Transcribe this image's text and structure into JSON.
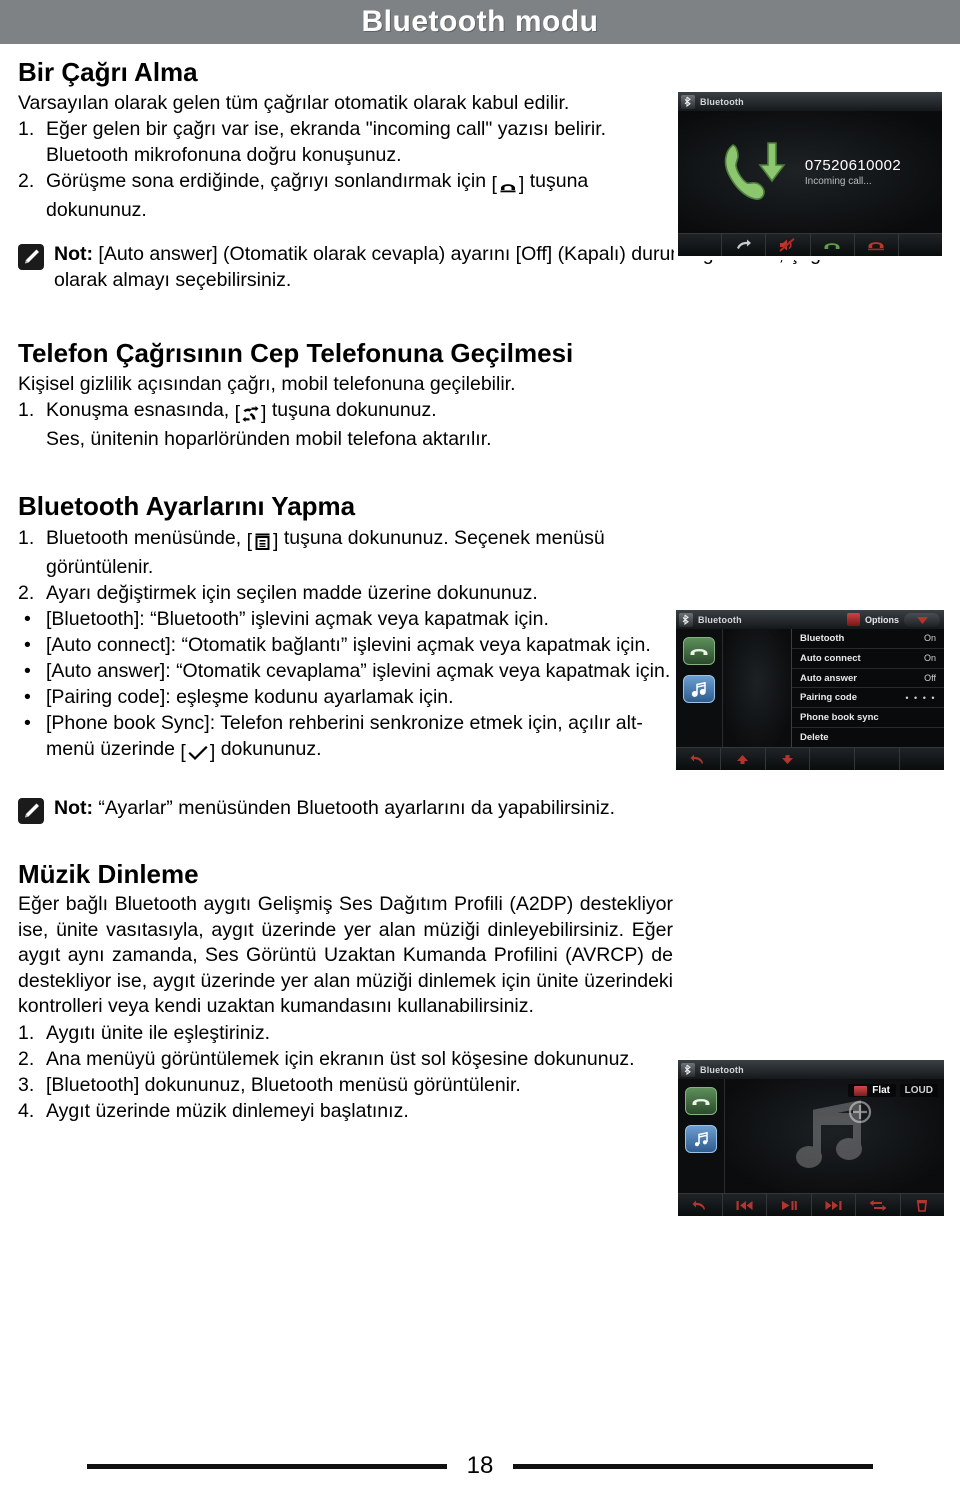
{
  "header": {
    "title": "Bluetooth modu",
    "band_color": "#7f8285"
  },
  "sections": {
    "receiving_call": {
      "heading": "Bir Çağrı Alma",
      "intro": "Varsayılan olarak gelen tüm çağrılar otomatik olarak kabul edilir.",
      "steps": [
        {
          "marker": "1.",
          "text": "Eğer gelen bir çağrı var ise, ekranda \"incoming call\" yazısı belirir. Bluetooth mikrofonuna doğru konuşunuz."
        },
        {
          "marker": "2.",
          "text_before": "Görüşme sona erdiğinde, çağrıyı sonlandırmak için",
          "icon": "hangup-handset-icon",
          "text_after": "tuşuna dokununuz."
        }
      ]
    },
    "note_1": {
      "icon": "pencil-note-icon",
      "label": "Not:",
      "text": " [Auto answer] (Otomatik olarak cevapla) ayarını [Off] (Kapalı) duruma getirerek, çağrıları manüel olarak almayı seçebilirsiniz."
    },
    "transfer_call": {
      "heading": "Telefon Çağrısının Cep Telefonuna Geçilmesi",
      "intro": "Kişisel gizlilik açısından çağrı, mobil telefonuna geçilebilir.",
      "steps": [
        {
          "marker": "1.",
          "text_before": "Konuşma esnasında,",
          "icon": "call-transfer-icon",
          "text_after": "tuşuna dokununuz."
        },
        {
          "marker": "",
          "text": "Ses, ünitenin hoparlöründen mobil telefona aktarılır."
        }
      ]
    },
    "bt_settings": {
      "heading": "Bluetooth Ayarlarını Yapma",
      "steps": [
        {
          "marker": "1.",
          "text_before": "Bluetooth menüsünde,",
          "icon": "options-menu-icon",
          "text_after": "tuşuna dokununuz. Seçenek menüsü görüntülenir."
        },
        {
          "marker": "2.",
          "text": "Ayarı değiştirmek için seçilen madde üzerine dokununuz."
        }
      ],
      "bullets": [
        {
          "marker": "•",
          "text": "[Bluetooth]: “Bluetooth” işlevini açmak veya kapatmak için."
        },
        {
          "marker": "•",
          "text": "[Auto connect]: “Otomatik bağlantı” işlevini açmak veya kapatmak için."
        },
        {
          "marker": "•",
          "text": "[Auto answer]: “Otomatik cevaplama” işlevini açmak veya kapatmak için."
        },
        {
          "marker": "•",
          "text": "[Pairing code]: eşleşme kodunu ayarlamak için."
        },
        {
          "marker": "•",
          "text_before": "[Phone book Sync]: Telefon rehberini senkronize etmek için, açılır alt-menü üzerinde",
          "icon": "checkmark-icon",
          "text_after": "dokununuz."
        }
      ]
    },
    "note_2": {
      "icon": "pencil-note-icon",
      "label": "Not:",
      "text": " “Ayarlar” menüsünden Bluetooth ayarlarını da yapabilirsiniz."
    },
    "music": {
      "heading": "Müzik Dinleme",
      "intro": "Eğer bağlı Bluetooth aygıtı Gelişmiş Ses Dağıtım Profili (A2DP) destekliyor ise, ünite vasıtasıyla, aygıt üzerinde yer alan müziği dinleyebilirsiniz.  Eğer aygıt aynı zamanda, Ses Görüntü Uzaktan Kumanda Profilini (AVRCP) de destekliyor ise, aygıt üzerinde yer alan müziği dinlemek için ünite üzerindeki kontrolleri veya kendi uzaktan kumandasını kullanabilirsiniz.",
      "steps": [
        {
          "marker": "1.",
          "text": "Aygıtı ünite ile eşleştiriniz."
        },
        {
          "marker": "2.",
          "text": "Ana menüyü görüntülemek için ekranın üst sol köşesine dokununuz."
        },
        {
          "marker": "3.",
          "text": "[Bluetooth] dokununuz, Bluetooth menüsü görüntülenir."
        },
        {
          "marker": "4.",
          "text": "Aygıt üzerinde müzik dinlemeyi başlatınız."
        }
      ]
    }
  },
  "screenshots": {
    "incoming_call": {
      "title": "Bluetooth",
      "number": "07520610002",
      "status": "Incoming call...",
      "bottom_buttons": [
        "transfer-icon",
        "mute-icon",
        "answer-call-icon",
        "end-call-icon"
      ]
    },
    "options": {
      "title": "Bluetooth",
      "panel_title": "Options",
      "rows": [
        {
          "label": "Bluetooth",
          "value": "On"
        },
        {
          "label": "Auto connect",
          "value": "On"
        },
        {
          "label": "Auto answer",
          "value": "Off"
        },
        {
          "label": "Pairing code",
          "value": "• • • •"
        },
        {
          "label": "Phone book sync",
          "value": ""
        },
        {
          "label": "Delete",
          "value": ""
        }
      ],
      "sidebar_icons": [
        "phone-icon",
        "music-note-icon"
      ],
      "bottom_buttons": [
        "back-icon",
        "up-icon",
        "down-icon"
      ]
    },
    "music_player": {
      "title": "Bluetooth",
      "eq_label": "Flat",
      "loud_label": "LOUD",
      "sidebar_icons": [
        "phone-icon",
        "music-note-icon"
      ],
      "bottom_buttons": [
        "back-icon",
        "previous-track-icon",
        "play-pause-icon",
        "next-track-icon",
        "repeat-icon",
        "delete-icon"
      ]
    }
  },
  "footer": {
    "page_number": "18"
  }
}
